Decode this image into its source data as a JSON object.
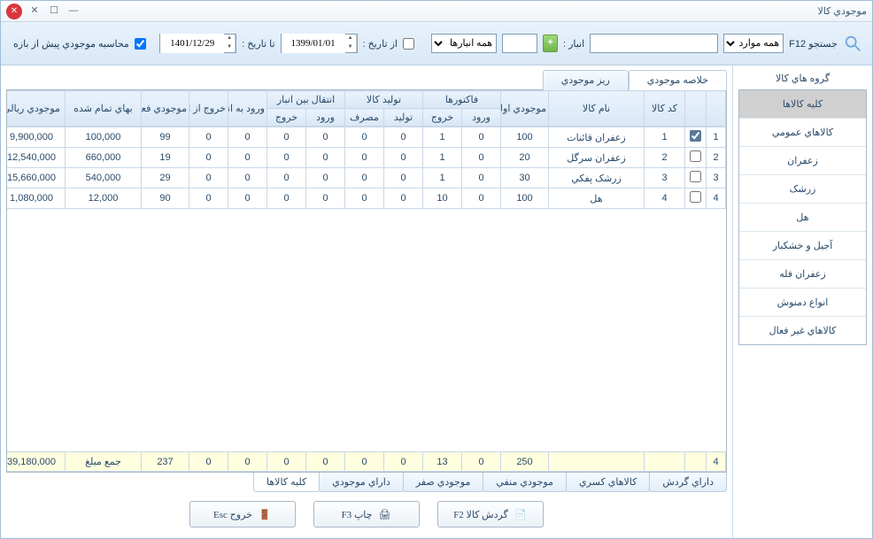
{
  "window": {
    "title": "موجودي کالا"
  },
  "toolbar": {
    "search_label": "جستجو F12",
    "search_mode": "همه موارد",
    "anbar_label": "انبار :",
    "anbar_select": "همه انبارها",
    "from_label": "از تاريخ :",
    "from_value": "1399/01/01",
    "to_label": "تا تاريخ :",
    "to_value": "1401/12/29",
    "calc_label": "محاسبه موجودي پيش از بازه"
  },
  "sidebar": {
    "title": "گروه هاي کالا",
    "items": [
      "کليه کالاها",
      "کالاهاي عمومي",
      "زعفران",
      "زرشک",
      "هل",
      "آجيل و خشکبار",
      "زعفران فله",
      "انواع دمنوش",
      "کالاهاي غير فعال"
    ],
    "selected": 0
  },
  "top_tabs": {
    "items": [
      "خلاصه موجودي",
      "ريز موجودي"
    ],
    "active": 0
  },
  "grid": {
    "headers_row1": [
      "",
      "",
      "کد کالا",
      "نام کالا",
      "موجودي اوليه",
      "فاکتورها",
      "",
      "توليد کالا",
      "",
      "انتقال بين انبار",
      "",
      "ورود به انبار",
      "خروج از انبار",
      "موجودي فعلي",
      "بهاي تمام شده",
      "موجودي ريالي"
    ],
    "headers_row2": [
      "",
      "",
      "",
      "",
      "",
      "ورود",
      "خروج",
      "توليد",
      "مصرف",
      "ورود",
      "خروج",
      "",
      "",
      "",
      "",
      ""
    ],
    "rows": [
      {
        "idx": "1",
        "chk": true,
        "code": "1",
        "name": "زعفران قائنات",
        "init": "100",
        "f_in": "0",
        "f_out": "1",
        "t_prod": "0",
        "t_cons": "0",
        "a_in": "0",
        "a_out": "0",
        "w_in": "0",
        "w_out": "0",
        "cur": "99",
        "cost": "100,000",
        "rial": "9,900,000"
      },
      {
        "idx": "2",
        "chk": false,
        "code": "2",
        "name": "زعفران سرگل",
        "init": "20",
        "f_in": "0",
        "f_out": "1",
        "t_prod": "0",
        "t_cons": "0",
        "a_in": "0",
        "a_out": "0",
        "w_in": "0",
        "w_out": "0",
        "cur": "19",
        "cost": "660,000",
        "rial": "12,540,000"
      },
      {
        "idx": "3",
        "chk": false,
        "code": "3",
        "name": "زرشک پفکي",
        "init": "30",
        "f_in": "0",
        "f_out": "1",
        "t_prod": "0",
        "t_cons": "0",
        "a_in": "0",
        "a_out": "0",
        "w_in": "0",
        "w_out": "0",
        "cur": "29",
        "cost": "540,000",
        "rial": "15,660,000"
      },
      {
        "idx": "4",
        "chk": false,
        "code": "4",
        "name": "هل",
        "init": "100",
        "f_in": "0",
        "f_out": "10",
        "t_prod": "0",
        "t_cons": "0",
        "a_in": "0",
        "a_out": "0",
        "w_in": "0",
        "w_out": "0",
        "cur": "90",
        "cost": "12,000",
        "rial": "1,080,000"
      }
    ],
    "footer": {
      "count": "4",
      "init": "250",
      "f_in": "0",
      "f_out": "13",
      "t_prod": "0",
      "t_cons": "0",
      "a_in": "0",
      "a_out": "0",
      "w_in": "0",
      "w_out": "0",
      "cur": "237",
      "cost_label": "جمع مبلغ",
      "rial": "39,180,000"
    }
  },
  "bottom_tabs": {
    "items": [
      "داراي گردش",
      "کالاهاي کسري",
      "موجودي منفي",
      "موجودي صفر",
      "داراي موجودي",
      "کليه کالاها"
    ],
    "active": 5
  },
  "actions": {
    "gardesh": "گردش کالا F2",
    "print": "چاپ F3",
    "exit": "خروج Esc"
  }
}
